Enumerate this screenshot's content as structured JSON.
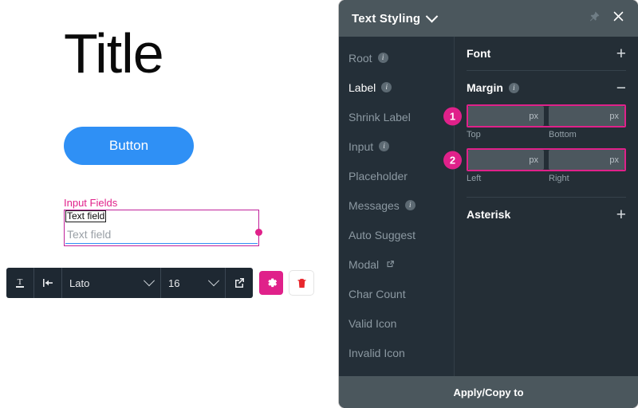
{
  "preview": {
    "title": "Title",
    "button_label": "Button",
    "input_fields_label": "Input Fields",
    "field_label": "Text field",
    "field_placeholder": "Text field",
    "accent_magenta": "#e0218a",
    "accent_blue": "#2f90f5"
  },
  "toolbar": {
    "text_icon": "text-underline-icon",
    "indent_icon": "indent-left-icon",
    "font_value": "Lato",
    "size_value": "16",
    "open_external_icon": "external-link-icon",
    "gear_icon": "gear-icon",
    "trash_icon": "trash-icon"
  },
  "panel": {
    "title": "Text Styling",
    "title_chevron_icon": "chevron-down-icon",
    "pin_icon": "pin-icon",
    "close_icon": "close-icon",
    "footer_label": "Apply/Copy to",
    "nav": [
      {
        "label": "Root",
        "info": true,
        "external": false,
        "active": false
      },
      {
        "label": "Label",
        "info": true,
        "external": false,
        "active": true
      },
      {
        "label": "Shrink Label",
        "info": false,
        "external": false,
        "active": false
      },
      {
        "label": "Input",
        "info": true,
        "external": false,
        "active": false
      },
      {
        "label": "Placeholder",
        "info": false,
        "external": false,
        "active": false
      },
      {
        "label": "Messages",
        "info": true,
        "external": false,
        "active": false
      },
      {
        "label": "Auto Suggest",
        "info": false,
        "external": false,
        "active": false
      },
      {
        "label": "Modal",
        "info": false,
        "external": true,
        "active": false
      },
      {
        "label": "Char Count",
        "info": false,
        "external": false,
        "active": false
      },
      {
        "label": "Valid Icon",
        "info": false,
        "external": false,
        "active": false
      },
      {
        "label": "Invalid Icon",
        "info": false,
        "external": false,
        "active": false
      }
    ],
    "sections": {
      "font": {
        "title": "Font",
        "toggle": "+"
      },
      "margin": {
        "title": "Margin",
        "toggle": "−",
        "badge_1": "1",
        "badge_2": "2",
        "top": {
          "label": "Top",
          "value": "",
          "unit": "px"
        },
        "bottom": {
          "label": "Bottom",
          "value": "",
          "unit": "px"
        },
        "left": {
          "label": "Left",
          "value": "",
          "unit": "px"
        },
        "right": {
          "label": "Right",
          "value": "",
          "unit": "px"
        }
      },
      "asterisk": {
        "title": "Asterisk",
        "toggle": "+"
      }
    }
  }
}
